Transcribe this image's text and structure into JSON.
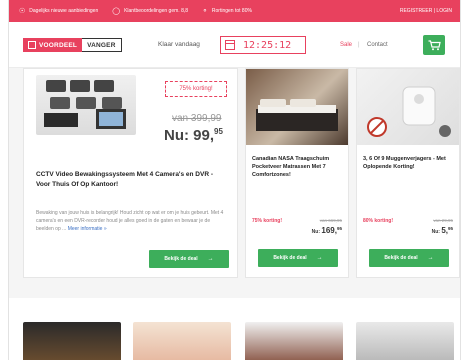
{
  "topbar": {
    "usp1": "Dagelijks nieuwe aanbiedingen",
    "usp2": "Klantbeoordelingen gem. 8,8",
    "usp3": "Rortingen tot 80%",
    "login": "REGISTREER | LOGIN"
  },
  "header": {
    "logo_part1": "VOORDEEL",
    "logo_part2": "VANGER",
    "timer_label": "Klaar vandaag",
    "timer_value": "12:25:12",
    "nav_sale": "Sale",
    "nav_sep": "|",
    "nav_contact": "Contact"
  },
  "featured": {
    "badge": "75% korting!",
    "was_price": "van 399,99",
    "now_prefix": "Nu: ",
    "now_main": "99,",
    "now_cents": "95",
    "title": "CCTV Video Bewakingssysteem Met 4 Camera's en DVR - Voor Thuis Of Op Kantoor!",
    "description": "Bewaking van jouw huis is belangrijk! Houd zicht op wat er om je huis gebeurt. Met 4 camera's en een DVR-recorder houd je alles goed in de gaten en bewaar je de beelden op ...",
    "more_link": "Meer informatie »",
    "button": "Bekijk de deal",
    "button_arrow": "→"
  },
  "deals": [
    {
      "title": "Canadian NASA Traagschuim Pocketveer Matrassen Met 7 Comfortzones!",
      "pct": "75% korting!",
      "was": "van 669,95",
      "now_prefix": "Nu: ",
      "now_main": "169,",
      "now_cents": "95",
      "button": "Bekijk de deal",
      "button_arrow": "→"
    },
    {
      "title": "3, 6 Of 9 Muggenverjagers - Met Oplopende Korting!",
      "pct": "80% korting!",
      "was": "van 29,95",
      "now_prefix": "Nu: ",
      "now_main": "5,",
      "now_cents": "95",
      "button": "Bekijk de deal",
      "button_arrow": "→"
    }
  ],
  "colors": {
    "brand_red": "#e8415e",
    "cta_green": "#3dae5b"
  },
  "icons": {
    "usp1": "tag-icon",
    "usp2": "thumbs-up-icon",
    "usp3": "price-tag-icon",
    "cart": "shopping-cart-icon"
  }
}
